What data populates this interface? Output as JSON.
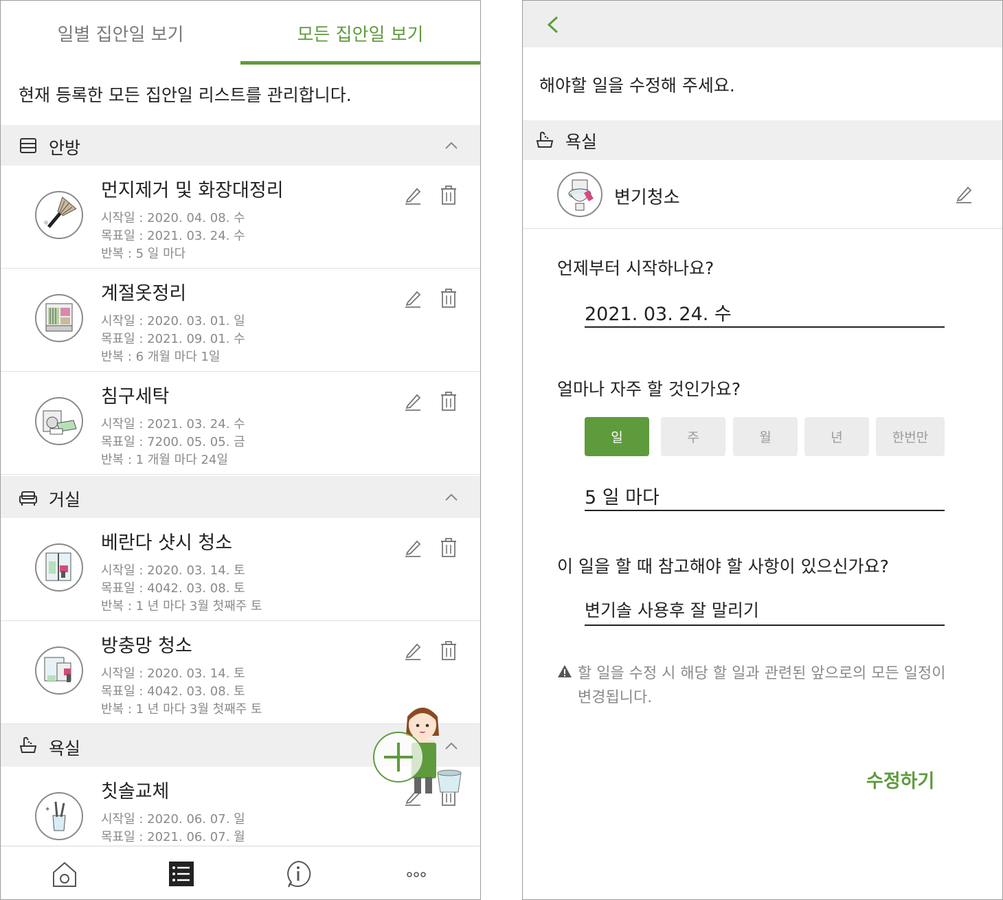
{
  "left": {
    "tabs": [
      "일별 집안일 보기",
      "모든 집안일 보기"
    ],
    "active_tab": 1,
    "description": "현재 등록한 모든 집안일 리스트를 관리합니다.",
    "sections": [
      {
        "label": "안방",
        "icon": "dresser-icon",
        "items": [
          {
            "title": "먼지제거 및 화장대정리",
            "start": "시작일 : 2020. 04. 08. 수",
            "target": "목표일 : 2021. 03. 24. 수",
            "repeat": "반복 : 5 일 마다",
            "icon": "duster-icon"
          },
          {
            "title": "계절옷정리",
            "start": "시작일 : 2020. 03. 01. 일",
            "target": "목표일 : 2021. 09. 01. 수",
            "repeat": "반복 : 6 개월 마다 1일",
            "icon": "closet-icon"
          },
          {
            "title": "침구세탁",
            "start": "시작일 : 2021. 03. 24. 수",
            "target": "목표일 : 7200. 05. 05. 금",
            "repeat": "반복 : 1 개월 마다 24일",
            "icon": "washing-machine-icon"
          }
        ]
      },
      {
        "label": "거실",
        "icon": "sofa-icon",
        "items": [
          {
            "title": "베란다 샷시 청소",
            "start": "시작일 : 2020. 03. 14. 토",
            "target": "목표일 : 4042. 03. 08. 토",
            "repeat": "반복 : 1 년 마다 3월 첫째주 토",
            "icon": "window-cleaning-icon"
          },
          {
            "title": "방충망 청소",
            "start": "시작일 : 2020. 03. 14. 토",
            "target": "목표일 : 4042. 03. 08. 토",
            "repeat": "반복 : 1 년 마다 3월 첫째주 토",
            "icon": "screen-cleaning-icon"
          }
        ]
      },
      {
        "label": "욕실",
        "icon": "bathtub-icon",
        "items": [
          {
            "title": "칫솔교체",
            "start": "시작일 : 2020. 06. 07. 일",
            "target": "목표일 : 2021. 06. 07. 월",
            "icon": "toothbrush-icon"
          }
        ]
      }
    ],
    "bottom_nav": [
      "home-icon",
      "list-icon",
      "info-icon",
      "more-icon"
    ]
  },
  "right": {
    "description": "해야할 일을 수정해 주세요.",
    "section_label": "욕실",
    "task_name": "변기청소",
    "q_start": "언제부터 시작하나요?",
    "start_value": "2021. 03. 24. 수",
    "q_freq": "얼마나 자주 할 것인가요?",
    "freq_options": [
      "일",
      "주",
      "월",
      "년",
      "한번만"
    ],
    "freq_selected": 0,
    "freq_value": "5 일 마다",
    "q_note": "이 일을 할 때 참고해야 할 사항이 있으신가요?",
    "note_value": "변기솔 사용후 잘 말리기",
    "warning": "할 일을 수정 시 해당 할 일과 관련된 앞으로의 모든 일정이 변경됩니다.",
    "submit_label": "수정하기"
  },
  "colors": {
    "accent": "#5e9b3c",
    "section_bg": "#efefef",
    "meta_text": "#8a8a8a"
  }
}
